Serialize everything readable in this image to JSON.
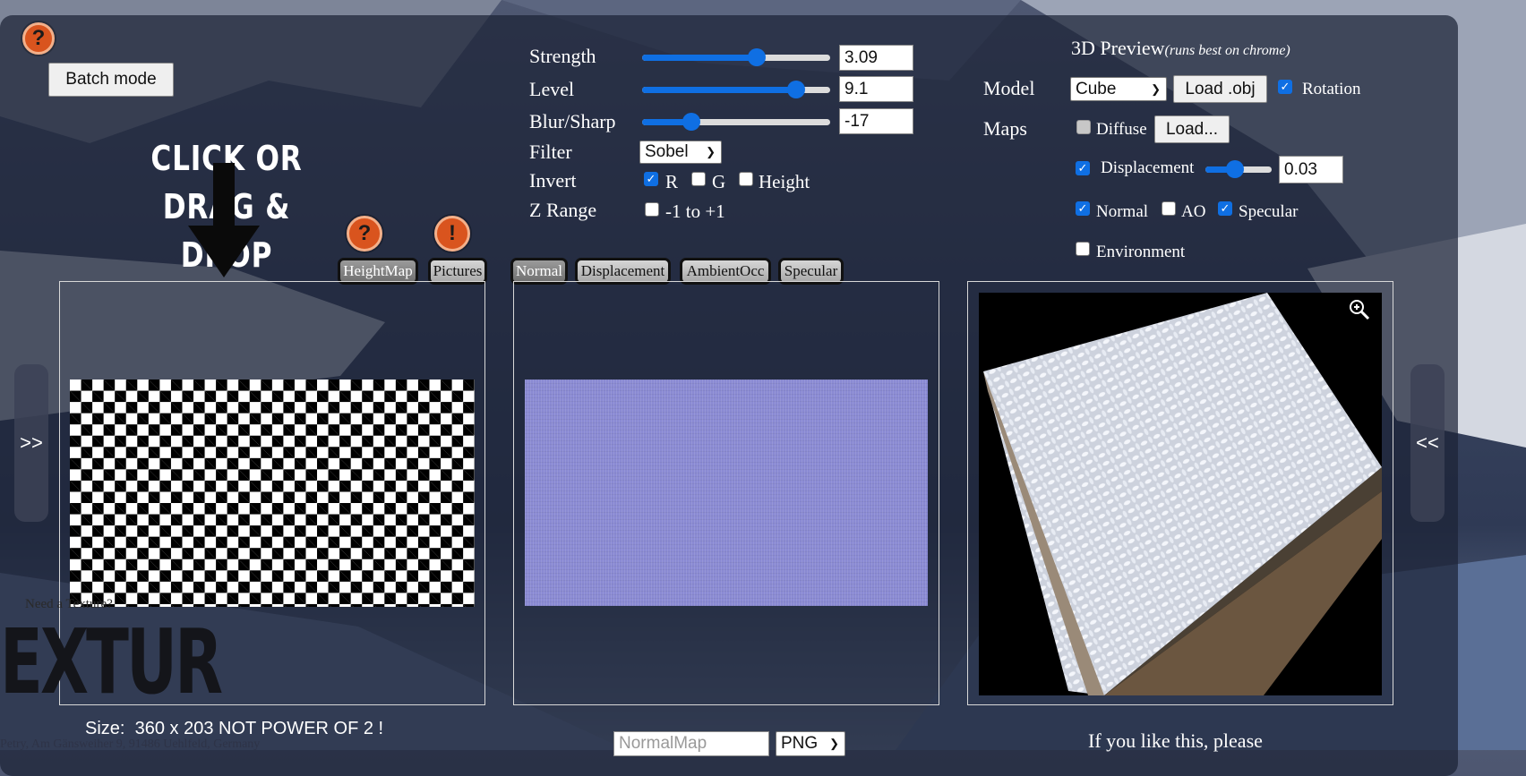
{
  "toolbar": {
    "batch_mode_label": "Batch mode",
    "help_icon": "?",
    "warning_icon": "!"
  },
  "drop_hint": {
    "line1": "CLICK OR",
    "line2": "DRAG & DROP"
  },
  "params": {
    "strength": {
      "label": "Strength",
      "value": "3.09",
      "slider_fraction": 0.61
    },
    "level": {
      "label": "Level",
      "value": "9.1",
      "slider_fraction": 0.82
    },
    "blur_sharp": {
      "label": "Blur/Sharp",
      "value": "-17",
      "slider_fraction": 0.26
    },
    "filter": {
      "label": "Filter",
      "selected": "Sobel"
    },
    "invert": {
      "label": "Invert",
      "r": "R",
      "g": "G",
      "height": "Height",
      "r_checked": true,
      "g_checked": false,
      "height_checked": false
    },
    "zrange": {
      "label": "Z Range",
      "option": "-1 to +1",
      "checked": false
    }
  },
  "preview3d": {
    "title": "3D Preview",
    "note": "(runs best on chrome)",
    "model_label": "Model",
    "model_selected": "Cube",
    "load_obj_label": "Load .obj",
    "rotation_label": "Rotation",
    "rotation_checked": true,
    "maps_label": "Maps",
    "diffuse_label": "Diffuse",
    "diffuse_checked": false,
    "load_label": "Load...",
    "displacement_label": "Displacement",
    "displacement_checked": true,
    "displacement_value": "0.03",
    "displacement_fraction": 0.45,
    "normal_label": "Normal",
    "normal_checked": true,
    "ao_label": "AO",
    "ao_checked": false,
    "specular_label": "Specular",
    "specular_checked": true,
    "environment_label": "Environment",
    "environment_checked": false,
    "zoom_icon": "zoom-in-icon"
  },
  "tabs_left": [
    "HeightMap",
    "Pictures"
  ],
  "tabs_right": [
    "Normal",
    "Displacement",
    "AmbientOcc",
    "Specular"
  ],
  "side": {
    "left_arrow": ">>",
    "right_arrow": "<<"
  },
  "footer": {
    "size_label": "Size:",
    "size_value": "360 x 203 NOT POWER OF 2 !",
    "filename_placeholder": "NormalMap",
    "format_selected": "PNG",
    "like_text": "If you like this, please",
    "need_texture": "Need a Texture?",
    "logo_text": "EXTUR",
    "credit": "Petry, Am Gänsweiher 9, 91486 Uehlfeld, Germany"
  }
}
